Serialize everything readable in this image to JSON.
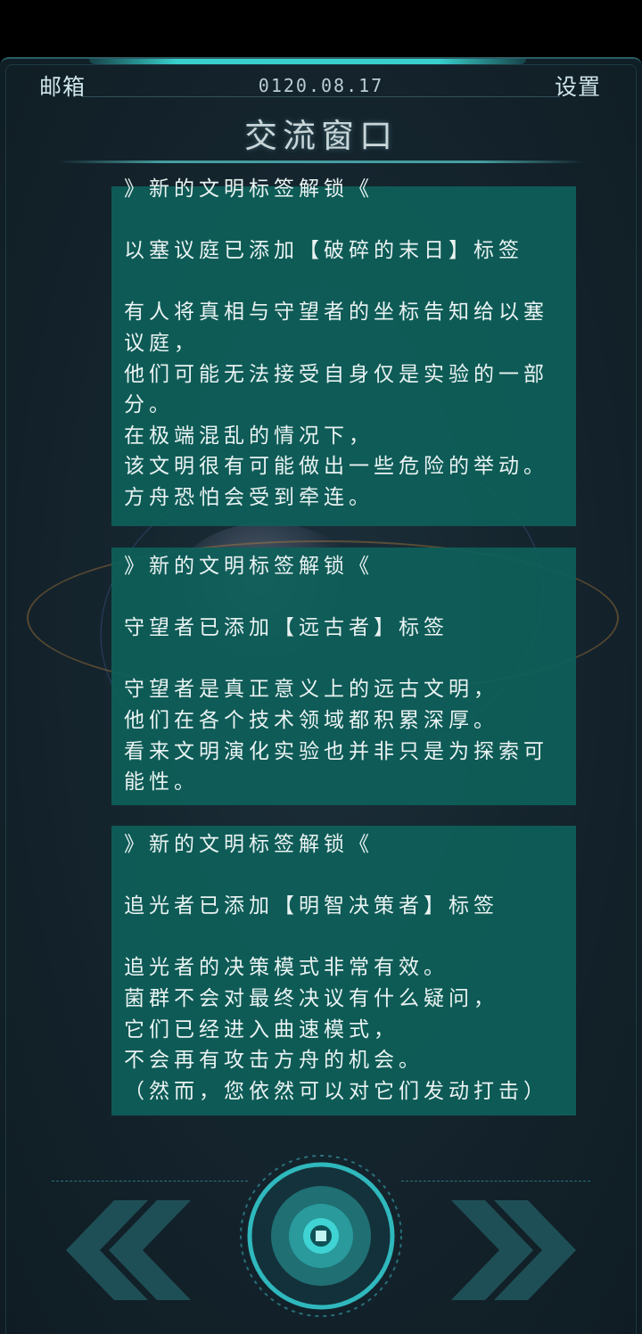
{
  "header": {
    "mailbox_label": "邮箱",
    "date": "0120.08.17",
    "settings_label": "设置",
    "title": "交流窗口"
  },
  "messages": [
    {
      "lines": [
        "》新的文明标签解锁《",
        "",
        "以塞议庭已添加【破碎的末日】标签",
        "",
        "有人将真相与守望者的坐标告知给以塞",
        "议庭，",
        "他们可能无法接受自身仅是实验的一部",
        "分。",
        "在极端混乱的情况下，",
        "该文明很有可能做出一些危险的举动。",
        "方舟恐怕会受到牵连。"
      ]
    },
    {
      "lines": [
        "》新的文明标签解锁《",
        "",
        "守望者已添加【远古者】标签",
        "",
        "守望者是真正意义上的远古文明，",
        "他们在各个技术领域都积累深厚。",
        "看来文明演化实验也并非只是为探索可",
        "能性。"
      ]
    },
    {
      "lines": [
        "》新的文明标签解锁《",
        "",
        "追光者已添加【明智决策者】标签",
        "",
        "追光者的决策模式非常有效。",
        "菌群不会对最终决议有什么疑问，",
        "它们已经进入曲速模式，",
        "不会再有攻击方舟的机会。",
        "（然而，您依然可以对它们发动打击）"
      ]
    }
  ],
  "colors": {
    "panel": "#0e605a",
    "accent": "#37d0cc",
    "arrow": "#1f4f56",
    "background": "#15252e"
  },
  "controls": {
    "prev_icon": "double-chevron-left-icon",
    "next_icon": "double-chevron-right-icon",
    "center_icon": "core-button-icon"
  }
}
